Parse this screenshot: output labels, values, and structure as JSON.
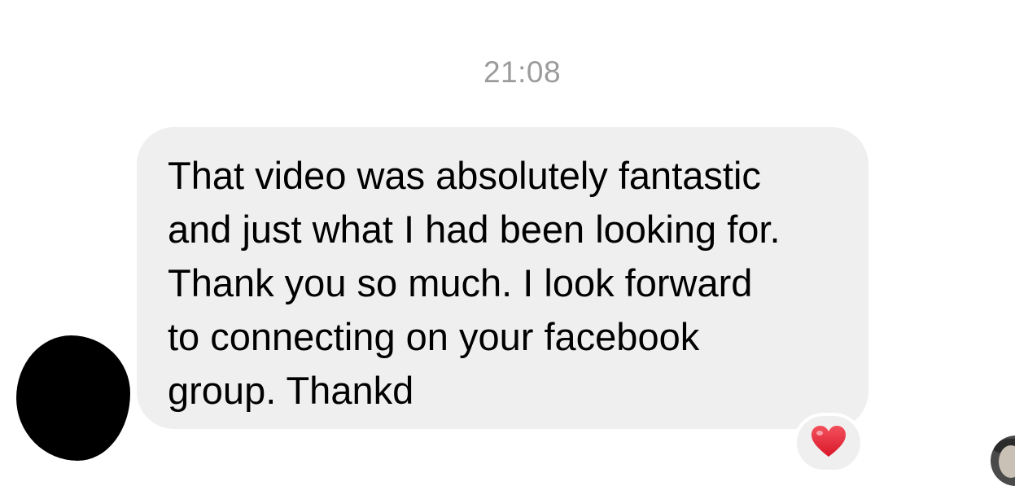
{
  "conversation": {
    "timestamp": "21:08",
    "message": {
      "text": "That video was absolutely fantastic\nand just what I had been looking for.\nThank you so much. I look forward\nto connecting on your facebook\ngroup. Thankd",
      "reaction": "heart-emoji"
    }
  },
  "colors": {
    "bubble_background": "#efefef",
    "timestamp_text": "#9b9b9b",
    "reaction_heart": "#e0202f"
  }
}
